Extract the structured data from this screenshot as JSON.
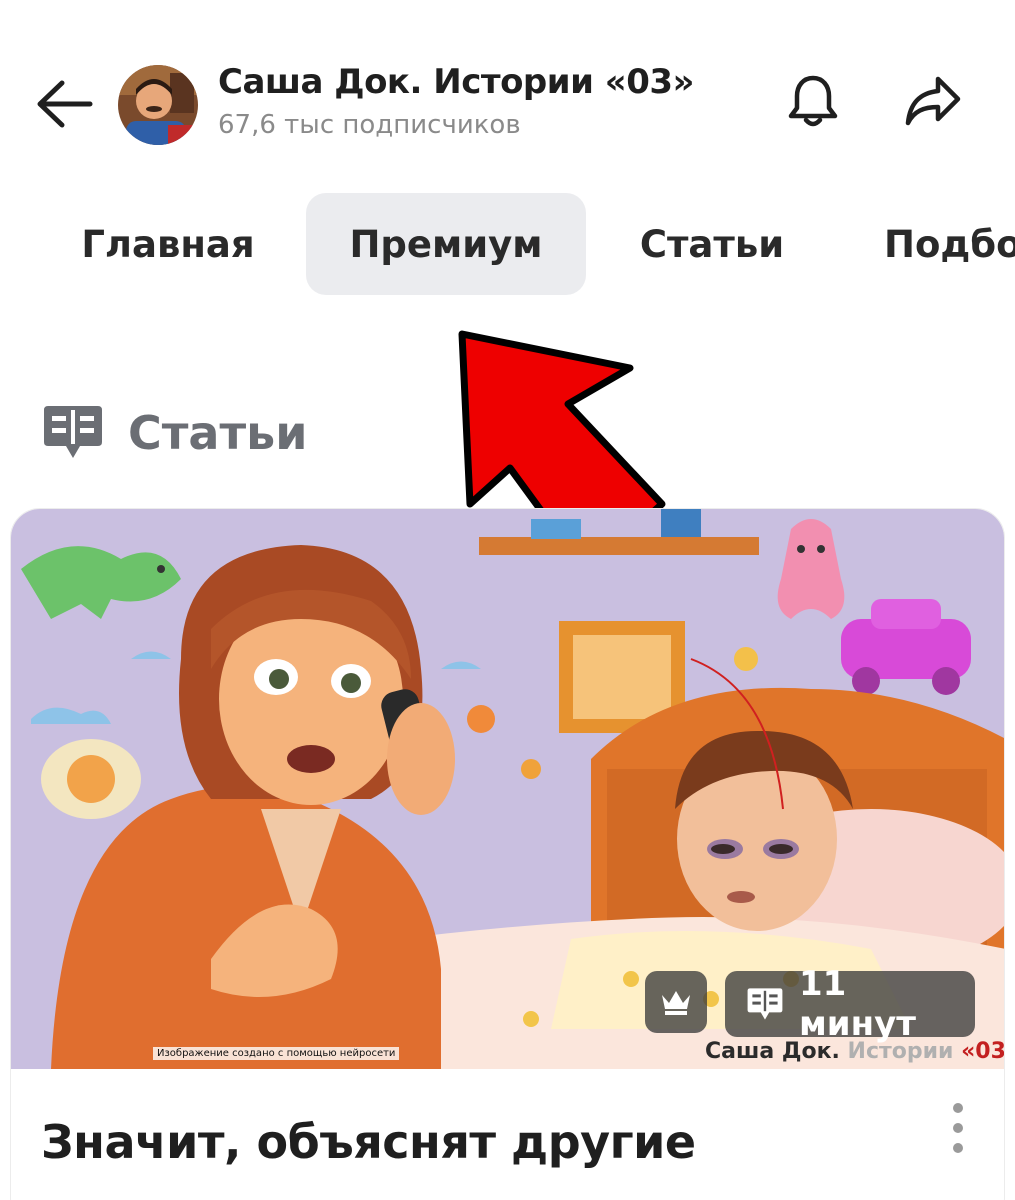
{
  "header": {
    "channel_name": "Саша Док. Истории «03»",
    "subscribers": "67,6 тыс подписчиков"
  },
  "tabs": [
    {
      "label": "Главная",
      "active": false
    },
    {
      "label": "Премиум",
      "active": true
    },
    {
      "label": "Статьи",
      "active": false
    },
    {
      "label": "Подбо",
      "active": false
    }
  ],
  "section": {
    "title": "Статьи",
    "icon": "article-icon"
  },
  "card": {
    "title": "Значит, объяснят другие",
    "read_time": "11 минут",
    "premium_icon": "crown-icon",
    "image_caption_left": "Изображение создано с помощью нейросети",
    "watermark": {
      "part1": "Саша Док. ",
      "part2": "Истории ",
      "part3": "«03»"
    }
  },
  "colors": {
    "active_tab_bg": "#ebecef",
    "arrow": "#ee0000",
    "muted_text": "#8a8a8a"
  }
}
